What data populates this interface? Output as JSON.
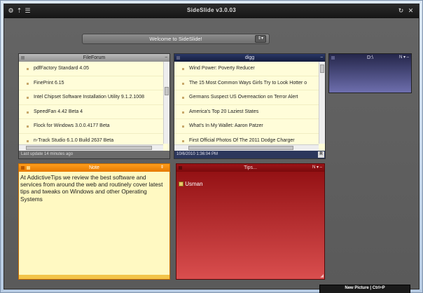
{
  "window": {
    "title": "SideSlide v3.0.03"
  },
  "welcome_bar": {
    "label": "Welcome to SideSlide!"
  },
  "feed_forum": {
    "title": "FileForum",
    "items": [
      "pdfFactory Standard 4.05",
      "FinePrint 6.15",
      "Intel Chipset Software Installation Utility 9.1.2.1008",
      "SpeedFan 4.42 Beta 4",
      "Flock for Windows 3.0.0.4177 Beta",
      "n-Track Studio 6.1.0 Build 2637 Beta"
    ],
    "status": "Last update 14 minutes ago"
  },
  "feed_digg": {
    "title": "digg",
    "items": [
      "Wind Power: Poverty Reducer",
      "The 15 Most Common Ways Girls Try to Look Hotter o",
      "Germans Suspect US Overreaction on Terror Alert",
      "America's Top 20 Laziest States",
      "What's In My Wallet: Aaron Patzer",
      "First Official Photos Of The 2011 Dodge Charger"
    ],
    "status": "10/6/2010 1:36:04 PM",
    "r_badge": "R"
  },
  "drive_panel": {
    "title": "D:\\"
  },
  "note": {
    "title": "Note",
    "text": "At AddictiveTips we review the best software and services from around the web and routinely cover latest tips and tweaks on Windows and other Operating Systems"
  },
  "tips": {
    "title": "Tips...",
    "contact_name": "Usman"
  },
  "toolbar": {
    "tooltip": "New Picture | Ctrl+P",
    "colors": [
      "#e06060",
      "#c8397a",
      "#d94b9a",
      "#b033b0",
      "#6fbf4a",
      "#43b35a",
      "#2fb0a8",
      "#2ba0d0",
      "#3a78d0",
      "#88a8c8",
      "#e8e8e8",
      "#b8b8b8"
    ]
  }
}
